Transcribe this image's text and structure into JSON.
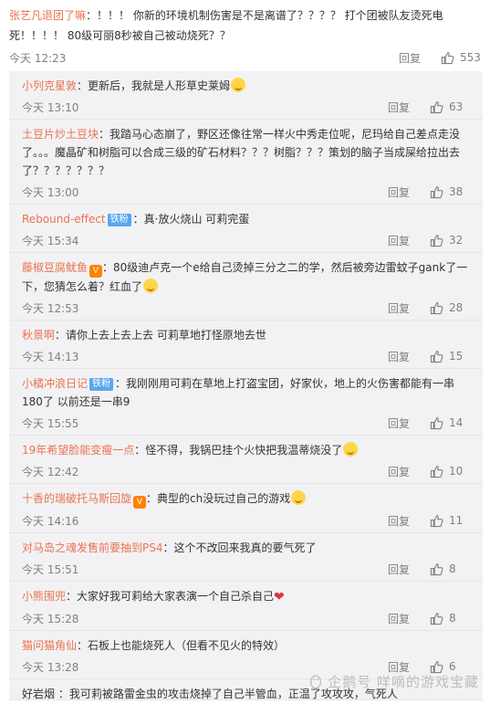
{
  "main": {
    "username": "张艺凡退团了嘛",
    "text": "：！！！ 你新的环境机制伤害是不是离谱了？？？？ 打个团被队友烫死电死！！！！ 80级可丽8秒被自己被动烧死？？",
    "time": "今天 12:23",
    "reply": "回复",
    "likes": "553"
  },
  "replies": [
    {
      "name": "小列克星敦",
      "badge": "",
      "vip": "",
      "text": "：更新后，我就是人形草史莱姆",
      "emoji": "smile",
      "time": "今天 13:10",
      "reply": "回复",
      "likes": "63"
    },
    {
      "name": "土豆片炒土豆块",
      "badge": "",
      "vip": "",
      "text": "：我踏马心态崩了，野区还像往常一样火中秀走位呢，尼玛给自己差点走没了。。。魔晶矿和树脂可以合成三级的矿石材料？？？树脂？？？策划的脑子当成屎给拉出去了？？？？？？？",
      "emoji": "",
      "time": "今天 13:00",
      "reply": "回复",
      "likes": "38"
    },
    {
      "name": "Rebound-effect",
      "badge": "铁粉",
      "vip": "",
      "text": "：真·放火烧山 可莉完蛋",
      "emoji": "",
      "time": "今天 15:34",
      "reply": "回复",
      "likes": "32"
    },
    {
      "name": "藤椒豆腐鱿鱼",
      "badge": "",
      "vip": "V",
      "text": "：80级迪卢克一个e给自己烫掉三分之二的学，然后被旁边雷蚊子gank了一下，您猜怎么着？红血了",
      "emoji": "smile",
      "time": "今天 12:53",
      "reply": "回复",
      "likes": "28"
    },
    {
      "name": "秋景啊",
      "badge": "",
      "vip": "",
      "text": "：请你上去上去上去 可莉草地打怪原地去世",
      "emoji": "",
      "time": "今天 14:13",
      "reply": "回复",
      "likes": "15"
    },
    {
      "name": "小橘冲浪日记",
      "badge": "铁粉",
      "vip": "",
      "text": "：我刚刚用可莉在草地上打盗宝团，好家伙，地上的火伤害都能有一串180了 以前还是一串9",
      "emoji": "",
      "time": "今天 15:55",
      "reply": "回复",
      "likes": "14"
    },
    {
      "name": "19年希望脸能变瘦一点",
      "badge": "",
      "vip": "",
      "text": "：怪不得，我锅巴挂个火快把我温蒂烧没了",
      "emoji": "smile",
      "time": "今天 12:42",
      "reply": "回复",
      "likes": "10"
    },
    {
      "name": "十香的瑞破托马斯回旋",
      "badge": "",
      "vip": "V",
      "text": "：典型的ch没玩过自己的游戏",
      "emoji": "smile",
      "time": "今天 14:16",
      "reply": "回复",
      "likes": "11"
    },
    {
      "name": "对马岛之魂发售前要抽到PS4",
      "badge": "",
      "vip": "",
      "text": "：这个不改回来我真的要气死了",
      "emoji": "",
      "time": "今天 15:51",
      "reply": "回复",
      "likes": "8"
    },
    {
      "name": "小熊围兜",
      "badge": "",
      "vip": "",
      "text": "：大家好我可莉给大家表演一个自己杀自己",
      "emoji": "heart",
      "time": "今天 15:28",
      "reply": "回复",
      "likes": "8"
    },
    {
      "name": "猫问猫角仙",
      "badge": "",
      "vip": "",
      "text": "：石板上也能烧死人（但看不见火的特效）",
      "emoji": "",
      "time": "今天 13:28",
      "reply": "回复",
      "likes": "6"
    }
  ],
  "watermark": "企鹅号 咩嘀的游戏宝藏",
  "cutoff_text": "好岩烟 ：我可莉被路雷金虫的攻击烧掉了自己半管血，正温了攻攻攻，气死人"
}
